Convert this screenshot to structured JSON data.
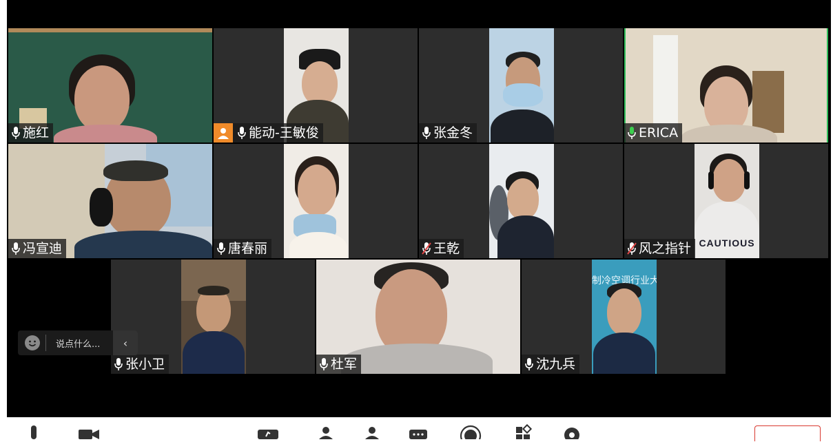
{
  "participants": [
    {
      "name": "施红",
      "muted": false,
      "active": false
    },
    {
      "name": "能动-王敏俊",
      "muted": false,
      "active": false,
      "has_avatar_badge": true
    },
    {
      "name": "张金冬",
      "muted": false,
      "active": false
    },
    {
      "name": "ERICA",
      "muted": false,
      "active": true
    },
    {
      "name": "冯宣迪",
      "muted": false,
      "active": false
    },
    {
      "name": "唐春丽",
      "muted": false,
      "active": false
    },
    {
      "name": "王乾",
      "muted": true,
      "active": false
    },
    {
      "name": "风之指针",
      "muted": true,
      "active": false
    },
    {
      "name": "张小卫",
      "muted": false,
      "active": false
    },
    {
      "name": "杜军",
      "muted": false,
      "active": false
    },
    {
      "name": "沈九兵",
      "muted": false,
      "active": false
    }
  ],
  "chat": {
    "placeholder": "说点什么..."
  },
  "background_text": {
    "banner": "制冷空调行业大"
  },
  "colors": {
    "active_speaker": "#2fbf5a",
    "muted_icon": "#e04646",
    "speaking_icon": "#3ccf4e",
    "leave": "#d8382f",
    "avatar_badge": "#f08b2a"
  }
}
